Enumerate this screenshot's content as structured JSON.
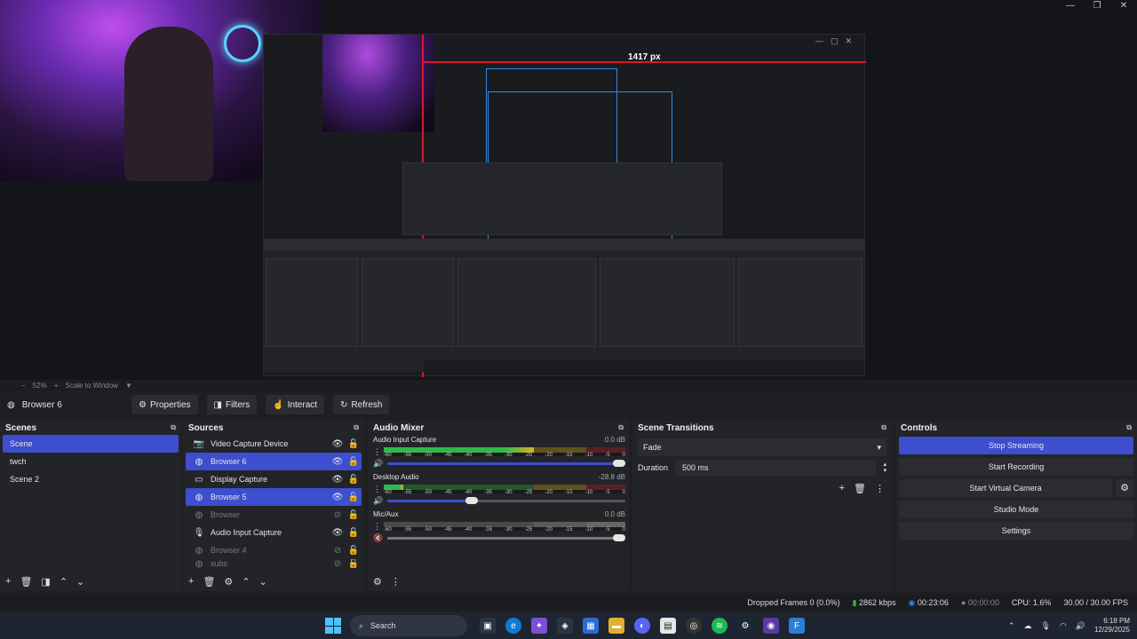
{
  "window": {
    "controls": [
      "—",
      "❐",
      "✕"
    ]
  },
  "preview": {
    "measurement_label": "1417 px"
  },
  "zoom": {
    "percent": "52%",
    "mode": "Scale to Window"
  },
  "source_toolbar": {
    "selected_source": "Browser 6",
    "properties": "Properties",
    "filters": "Filters",
    "interact": "Interact",
    "refresh": "Refresh"
  },
  "scenes": {
    "title": "Scenes",
    "items": [
      {
        "label": "Scene",
        "selected": true
      },
      {
        "label": "twch",
        "selected": false
      },
      {
        "label": "Scene 2",
        "selected": false
      }
    ]
  },
  "sources": {
    "title": "Sources",
    "items": [
      {
        "label": "Video Capture Device",
        "icon": "camera-icon",
        "selected": false,
        "visible": true
      },
      {
        "label": "Browser 6",
        "icon": "globe-icon",
        "selected": true,
        "visible": true
      },
      {
        "label": "Display Capture",
        "icon": "monitor-icon",
        "selected": false,
        "visible": true
      },
      {
        "label": "Browser 5",
        "icon": "globe-icon",
        "selected": true,
        "visible": true
      },
      {
        "label": "Browser",
        "icon": "globe-icon",
        "selected": false,
        "visible": false
      },
      {
        "label": "Audio Input Capture",
        "icon": "microphone-icon",
        "selected": false,
        "visible": true
      },
      {
        "label": "Browser 4",
        "icon": "globe-icon",
        "selected": false,
        "visible": false
      },
      {
        "label": "subs",
        "icon": "globe-icon",
        "selected": false,
        "visible": false
      }
    ]
  },
  "audio_mixer": {
    "title": "Audio Mixer",
    "ticks": [
      "-60",
      "-55",
      "-50",
      "-45",
      "-40",
      "-35",
      "-30",
      "-25",
      "-20",
      "-15",
      "-10",
      "-5",
      "0"
    ],
    "channels": [
      {
        "name": "Audio Input Capture",
        "db": "0.0 dB",
        "level": 0.62,
        "fader": 1.0,
        "muted": false
      },
      {
        "name": "Desktop Audio",
        "db": "-28.8 dB",
        "level": 0.08,
        "fader": 0.38,
        "muted": false
      },
      {
        "name": "Mic/Aux",
        "db": "0.0 dB",
        "level": 0.0,
        "fader": 1.0,
        "muted": true
      }
    ]
  },
  "scene_transitions": {
    "title": "Scene Transitions",
    "transition": "Fade",
    "duration_label": "Duration",
    "duration_value": "500 ms"
  },
  "controls": {
    "title": "Controls",
    "stop_streaming": "Stop Streaming",
    "start_recording": "Start Recording",
    "start_virtual_camera": "Start Virtual Camera",
    "studio_mode": "Studio Mode",
    "settings": "Settings"
  },
  "status": {
    "dropped_frames": "Dropped Frames 0 (0.0%)",
    "bitrate": "2862 kbps",
    "stream_time": "00:23:06",
    "record_time": "00:00:00",
    "cpu": "CPU: 1.6%",
    "fps": "30.00 / 30.00 FPS"
  },
  "taskbar": {
    "search_placeholder": "Search",
    "time": "6:18 PM",
    "date": "12/29/2025"
  },
  "colors": {
    "accent": "#3d4ecf",
    "red_guide": "#d41a2a",
    "blue_guide": "#2c8ce6",
    "meter_green": "#2fb84a",
    "meter_yellow": "#d6b22a",
    "meter_red": "#c02a38"
  }
}
